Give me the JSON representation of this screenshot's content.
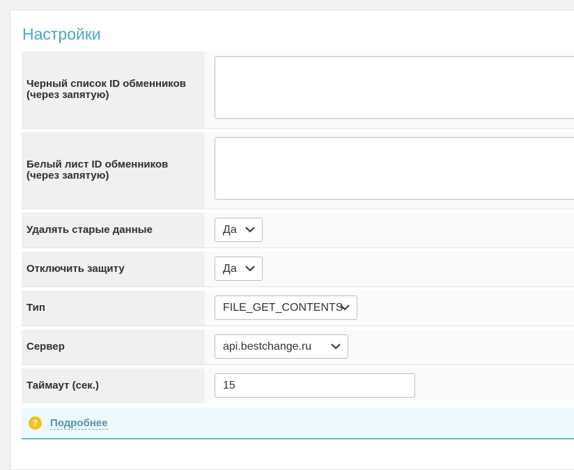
{
  "page": {
    "title": "Настройки"
  },
  "settings": {
    "blacklist": {
      "label": "Черный список ID обменников (через запятую)",
      "value": ""
    },
    "whitelist": {
      "label": "Белый лист ID обменников (через запятую)",
      "value": ""
    },
    "delete_old": {
      "label": "Удалять старые данные",
      "value": "Да"
    },
    "disable_protection": {
      "label": "Отключить защиту",
      "value": "Да"
    },
    "type": {
      "label": "Тип",
      "value": "FILE_GET_CONTENTS"
    },
    "server": {
      "label": "Сервер",
      "value": "api.bestchange.ru"
    },
    "timeout": {
      "label": "Таймаут (сек.)",
      "value": "15"
    }
  },
  "info": {
    "icon": "question-circle-icon",
    "link_text": "Подробнее"
  },
  "colors": {
    "title": "#4aa8c4",
    "info_bg": "#ecf9fd",
    "info_border": "#69b8d2",
    "question_icon": "#f2c21b"
  }
}
